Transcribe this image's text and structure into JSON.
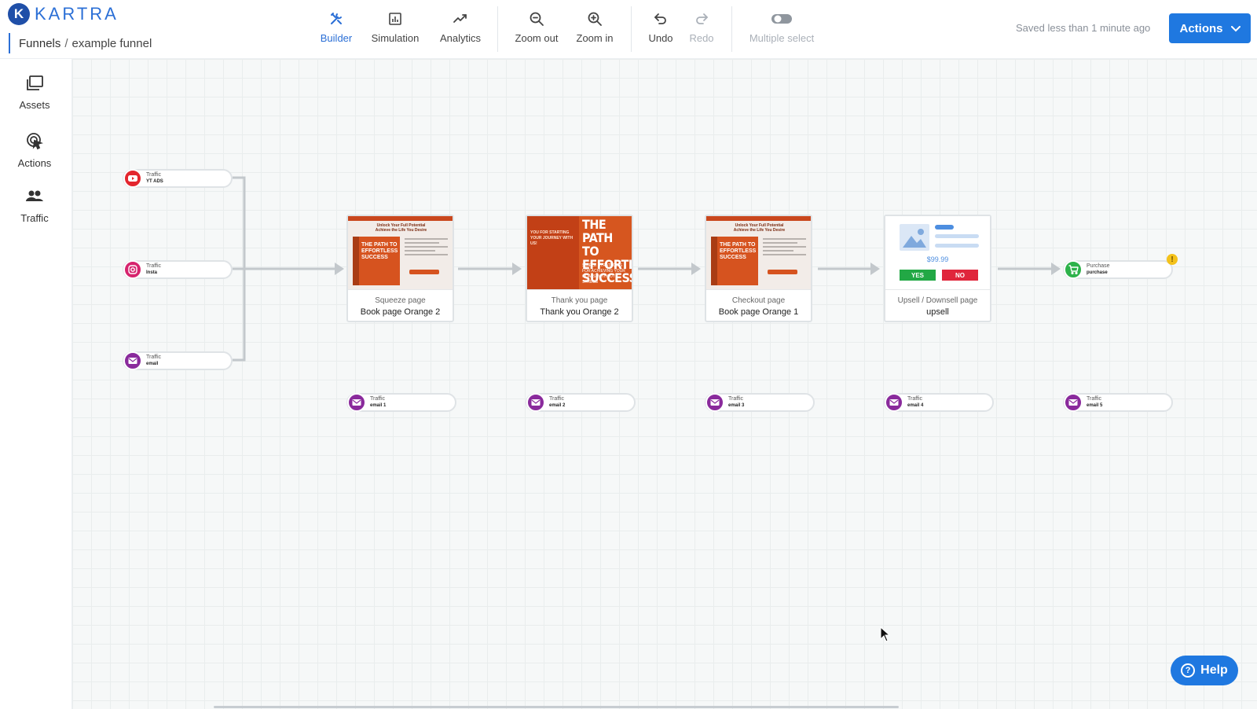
{
  "brand": {
    "logo_letter": "K",
    "name": "KARTRA",
    "accent": "#1f78e0"
  },
  "breadcrumb": {
    "parent": "Funnels",
    "separator": "/",
    "current": "example funnel"
  },
  "toolbar": {
    "builder": "Builder",
    "simulation": "Simulation",
    "analytics": "Analytics",
    "zoom_out": "Zoom out",
    "zoom_in": "Zoom in",
    "undo": "Undo",
    "redo": "Redo",
    "multiple_select": "Multiple select"
  },
  "status": {
    "saved": "Saved less than 1 minute ago"
  },
  "actions_button": "Actions",
  "sidebar": {
    "assets": "Assets",
    "actions": "Actions",
    "traffic": "Traffic"
  },
  "traffic_sources": [
    {
      "type": "Traffic",
      "name": "YT ADS",
      "icon": "youtube-icon",
      "color": "#e3262e"
    },
    {
      "type": "Traffic",
      "name": "Insta",
      "icon": "instagram-icon",
      "color": "#d6246e"
    },
    {
      "type": "Traffic",
      "name": "email",
      "icon": "email-icon",
      "color": "#8a2a9c"
    }
  ],
  "pages": [
    {
      "type": "Squeeze page",
      "name": "Book page Orange 2"
    },
    {
      "type": "Thank you page",
      "name": "Thank you Orange 2"
    },
    {
      "type": "Checkout page",
      "name": "Book page Orange 1"
    },
    {
      "type": "Upsell / Downsell page",
      "name": "upsell"
    }
  ],
  "thumbs": {
    "book_headline": "Unlock Your Full Potential Achieve the Life You Desire",
    "book_title": "THE PATH TO EFFORTLESS SUCCESS",
    "ty_left": "YOU FOR STARTING YOUR JOURNEY WITH US!",
    "ty_big": "THE PATH TO EFFORTLESS SUCCESS",
    "ty_sub": "SIMPLE STRATEGIES FOR ACHIEVING YOUR GOALS WITHOUT STRESS",
    "upsell_price": "$99.99",
    "upsell_yes": "YES",
    "upsell_no": "NO"
  },
  "purchase": {
    "type": "Purchase",
    "name": "purchase",
    "icon": "cart-icon",
    "color": "#2db24a",
    "warning": "!"
  },
  "email_nodes": [
    {
      "type": "Traffic",
      "name": "email 1"
    },
    {
      "type": "Traffic",
      "name": "email 2"
    },
    {
      "type": "Traffic",
      "name": "email 3"
    },
    {
      "type": "Traffic",
      "name": "email 4"
    },
    {
      "type": "Traffic",
      "name": "email 5"
    }
  ],
  "help": "Help"
}
